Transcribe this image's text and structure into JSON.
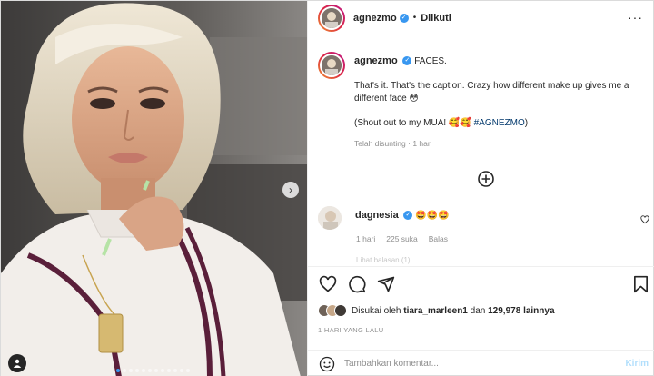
{
  "post": {
    "author": "agnezmo",
    "follow_status": "Diikuti",
    "follow_separator": "•"
  },
  "caption": {
    "author": "agnezmo",
    "title": "FACES.",
    "line1": "That's it. That's the caption. Crazy how different make up gives me a",
    "line2": "different face 😳",
    "line3_text": "(Shout out to my MUA! 🥰🥰 ",
    "line3_tag": "#AGNEZMO",
    "line3_close": ")",
    "edited": "Telah disunting",
    "sep": "·",
    "time": "1 hari"
  },
  "comment": {
    "author": "dagnesia",
    "text": "🤩🤩🤩",
    "time": "1 hari",
    "likes": "225 suka",
    "reply": "Balas",
    "view_replies": "Lihat balasan (1)"
  },
  "likes": {
    "prefix": "Disukai oleh",
    "user": "tiara_marleen1",
    "and": "dan",
    "count": "129,978",
    "suffix": "lainnya"
  },
  "date_label": "1 HARI YANG LALU",
  "comment_box": {
    "placeholder": "Tambahkan komentar...",
    "post_label": "Kirim"
  },
  "carousel": {
    "total": 12,
    "active": 0
  },
  "icons": {
    "verified": "verified-badge-icon",
    "more": "more-options-icon",
    "load_more": "plus-circle-icon",
    "heart": "heart-icon",
    "comment": "comment-icon",
    "share": "share-icon",
    "save": "bookmark-icon",
    "emoji": "emoji-icon",
    "next": "chevron-right-icon",
    "tag": "user-tag-icon"
  },
  "colors": {
    "link": "#00376b",
    "verified": "#3897f0",
    "muted": "#8e8e8e",
    "post_disabled": "#b2dffc"
  }
}
